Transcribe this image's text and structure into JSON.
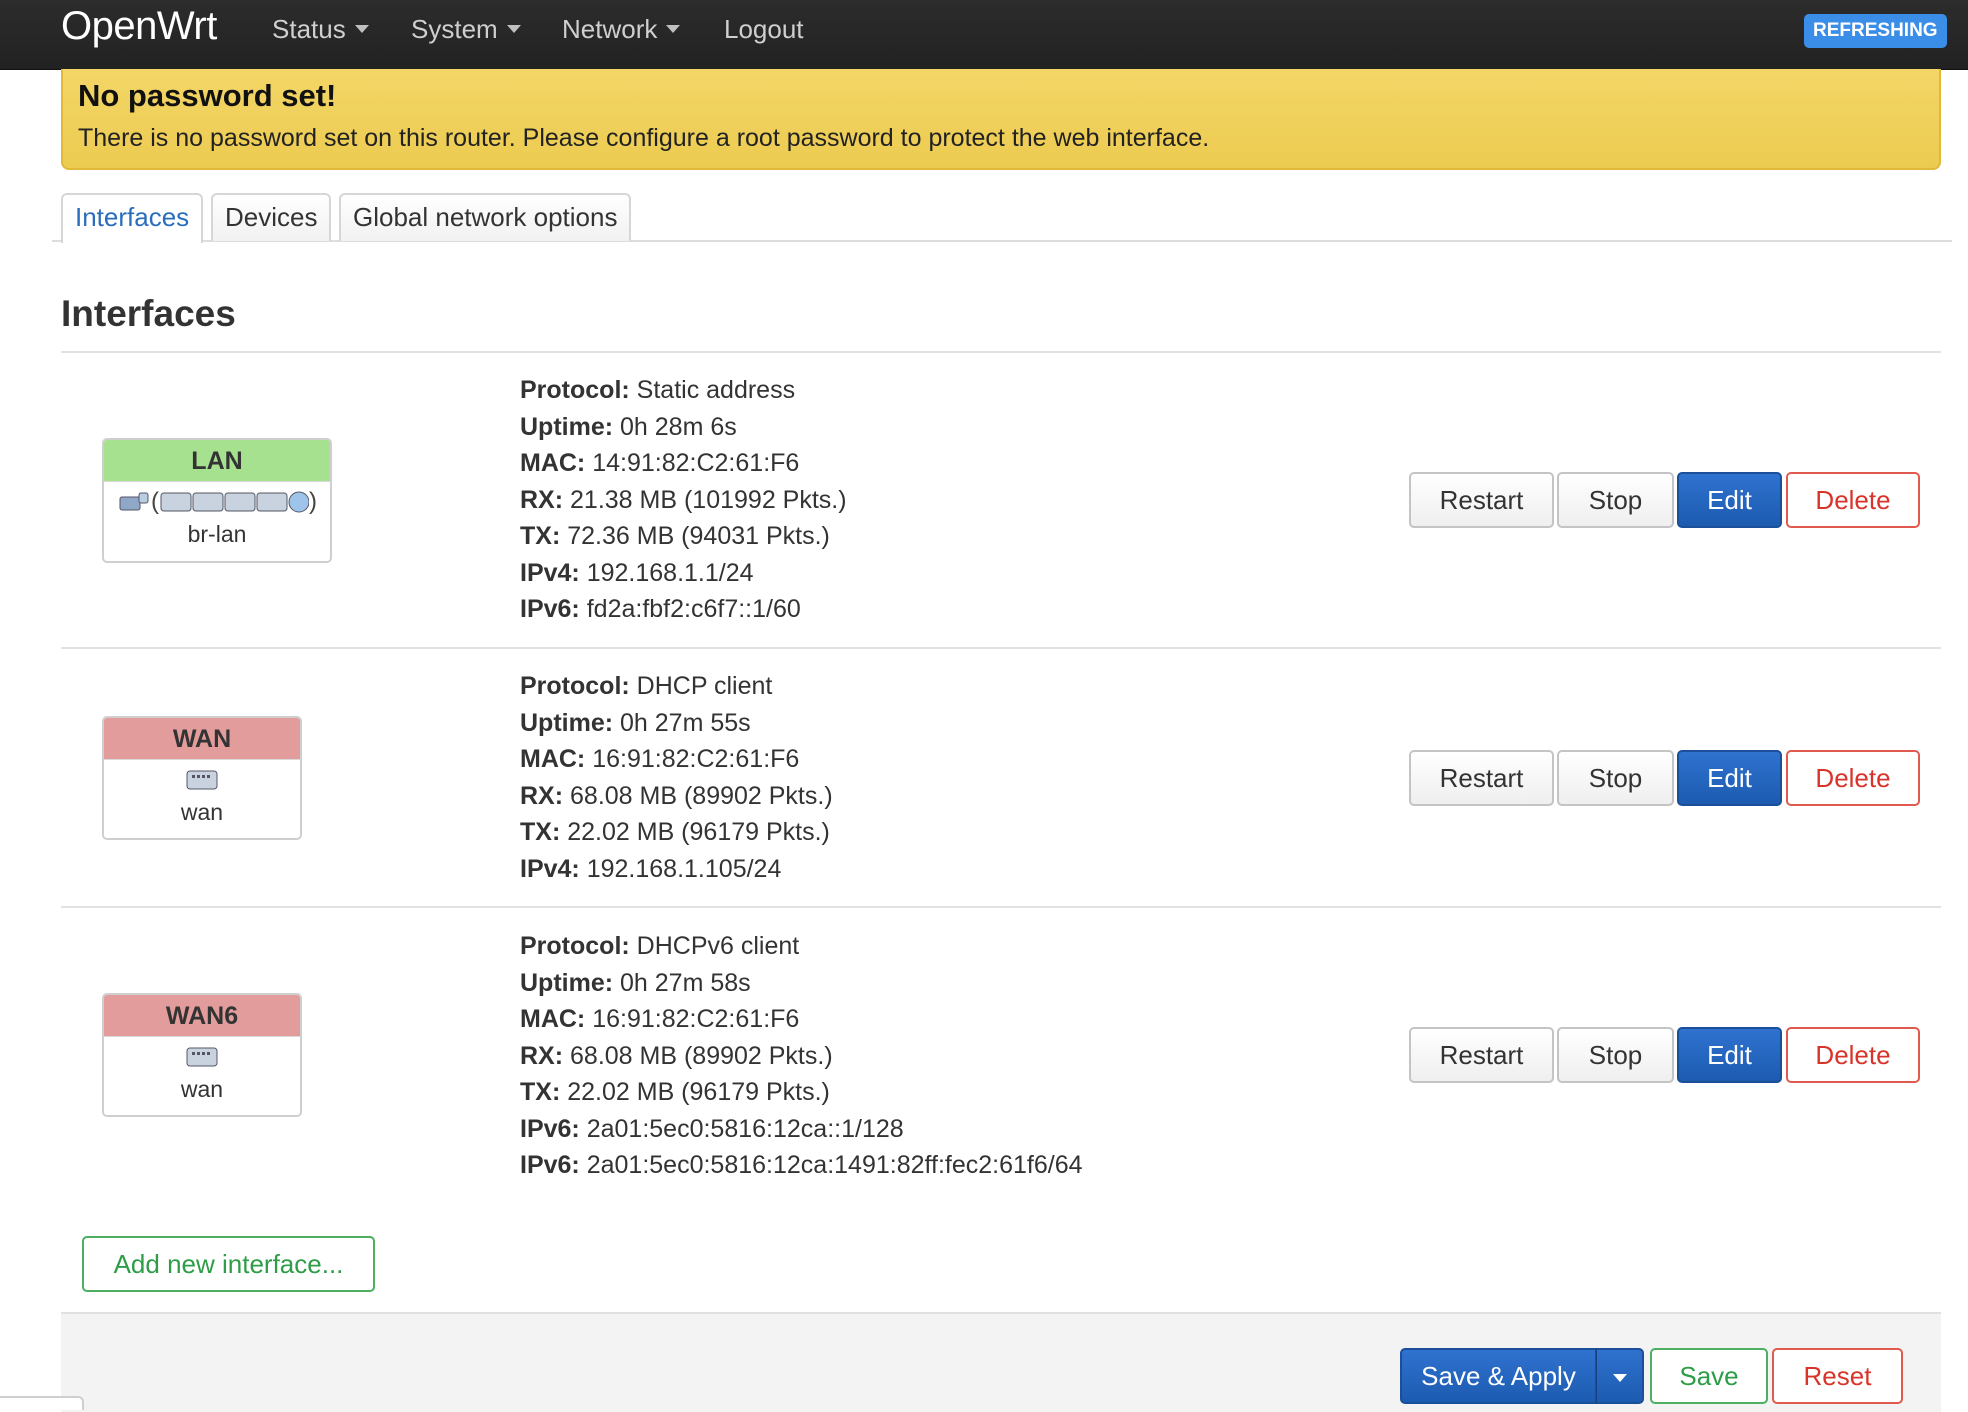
{
  "nav": {
    "brand": "OpenWrt",
    "items": [
      {
        "label": "Status",
        "dropdown": true
      },
      {
        "label": "System",
        "dropdown": true
      },
      {
        "label": "Network",
        "dropdown": true
      },
      {
        "label": "Logout",
        "dropdown": false
      }
    ],
    "refresh_badge": "REFRESHING"
  },
  "alert": {
    "title": "No password set!",
    "message": "There is no password set on this router. Please configure a root password to protect the web interface."
  },
  "tabs": [
    {
      "label": "Interfaces",
      "active": true
    },
    {
      "label": "Devices",
      "active": false
    },
    {
      "label": "Global network options",
      "active": false
    }
  ],
  "section_title": "Interfaces",
  "interfaces": [
    {
      "name": "LAN",
      "device": "br-lan",
      "color": "#a6e190",
      "rows": [
        {
          "label": "Protocol:",
          "value": "Static address"
        },
        {
          "label": "Uptime:",
          "value": "0h 28m 6s"
        },
        {
          "label": "MAC:",
          "value": "14:91:82:C2:61:F6"
        },
        {
          "label": "RX:",
          "value": "21.38 MB (101992 Pkts.)"
        },
        {
          "label": "TX:",
          "value": "72.36 MB (94031 Pkts.)"
        },
        {
          "label": "IPv4:",
          "value": "192.168.1.1/24"
        },
        {
          "label": "IPv6:",
          "value": "fd2a:fbf2:c6f7::1/60"
        }
      ]
    },
    {
      "name": "WAN",
      "device": "wan",
      "color": "#e39c9c",
      "rows": [
        {
          "label": "Protocol:",
          "value": "DHCP client"
        },
        {
          "label": "Uptime:",
          "value": "0h 27m 55s"
        },
        {
          "label": "MAC:",
          "value": "16:91:82:C2:61:F6"
        },
        {
          "label": "RX:",
          "value": "68.08 MB (89902 Pkts.)"
        },
        {
          "label": "TX:",
          "value": "22.02 MB (96179 Pkts.)"
        },
        {
          "label": "IPv4:",
          "value": "192.168.1.105/24"
        }
      ]
    },
    {
      "name": "WAN6",
      "device": "wan",
      "color": "#e39c9c",
      "rows": [
        {
          "label": "Protocol:",
          "value": "DHCPv6 client"
        },
        {
          "label": "Uptime:",
          "value": "0h 27m 58s"
        },
        {
          "label": "MAC:",
          "value": "16:91:82:C2:61:F6"
        },
        {
          "label": "RX:",
          "value": "68.08 MB (89902 Pkts.)"
        },
        {
          "label": "TX:",
          "value": "22.02 MB (96179 Pkts.)"
        },
        {
          "label": "IPv6:",
          "value": "2a01:5ec0:5816:12ca::1/128"
        },
        {
          "label": "IPv6:",
          "value": "2a01:5ec0:5816:12ca:1491:82ff:fec2:61f6/64"
        }
      ]
    }
  ],
  "row_buttons": {
    "restart": "Restart",
    "stop": "Stop",
    "edit": "Edit",
    "delete": "Delete"
  },
  "add_interface_label": "Add new interface...",
  "footer": {
    "save_apply": "Save & Apply",
    "save": "Save",
    "reset": "Reset"
  },
  "colors": {
    "primary": "#2f72cf",
    "danger": "#d9342b",
    "success": "#2e9d48",
    "alert": "#f0d25d",
    "navbar": "#222222"
  }
}
